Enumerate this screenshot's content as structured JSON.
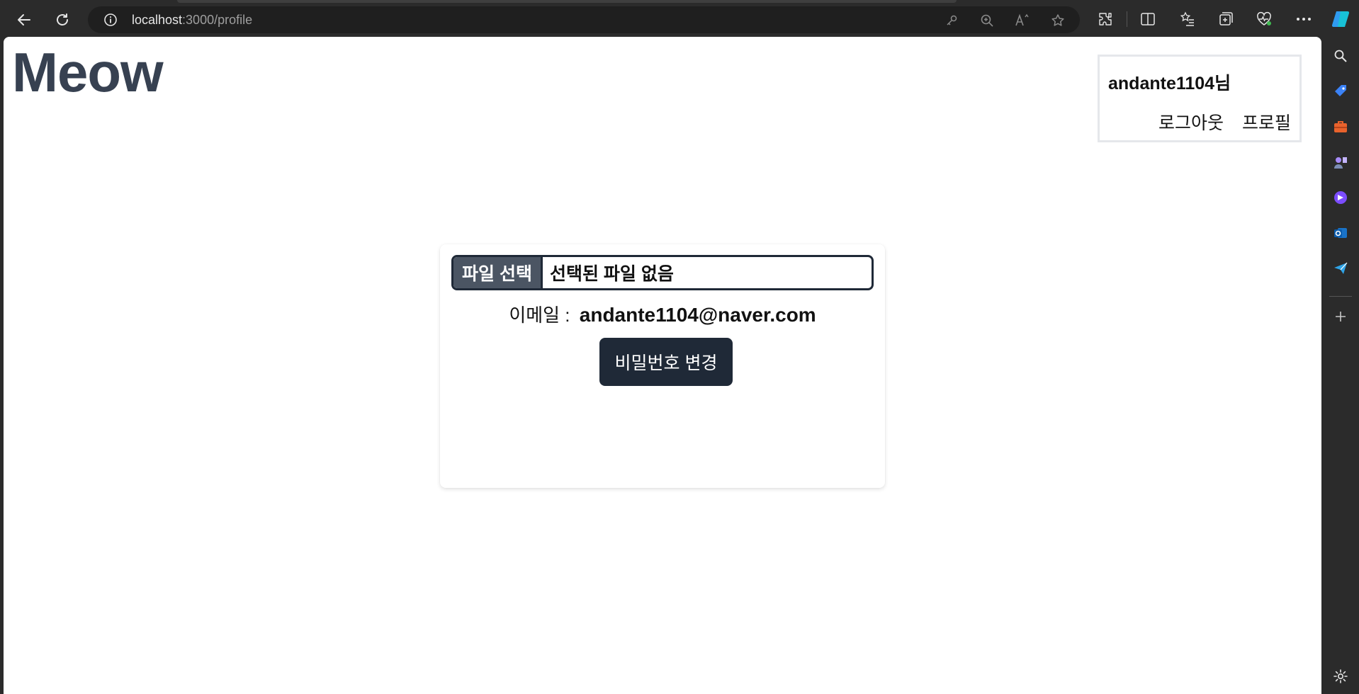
{
  "browser": {
    "url_host": "localhost",
    "url_path": ":3000/profile"
  },
  "page": {
    "logo": "Meow",
    "user": {
      "greeting": "andante1104님",
      "logout_label": "로그아웃",
      "profile_label": "프로필"
    },
    "profile_card": {
      "file_button_label": "파일 선택",
      "file_status": "선택된 파일 없음",
      "email_label": "이메일 :",
      "email_value": "andante1104@naver.com",
      "change_password_label": "비밀번호 변경"
    }
  },
  "colors": {
    "logo": "#374151",
    "button_dark": "#1f2937",
    "file_button": "#4b5563",
    "browser_chrome": "#2b2b2b"
  }
}
